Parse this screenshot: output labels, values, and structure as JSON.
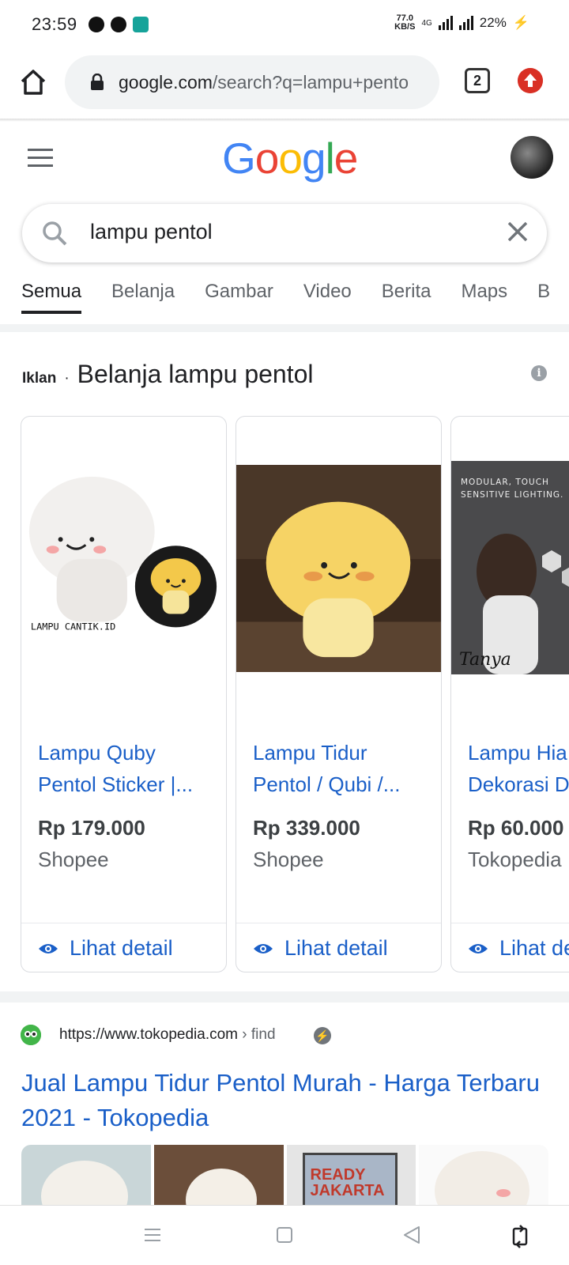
{
  "status_bar": {
    "time": "23:59",
    "net_speed_value": "77.0",
    "net_speed_unit": "KB/S",
    "network_type": "4G",
    "battery": "22%"
  },
  "browser": {
    "url_host": "google.com",
    "url_path": "/search?q=lampu+pento",
    "tab_count": "2"
  },
  "google": {
    "logo_letters": [
      "G",
      "o",
      "o",
      "g",
      "l",
      "e"
    ],
    "logo_colors": [
      "#4285F4",
      "#EA4335",
      "#FBBC05",
      "#4285F4",
      "#34A853",
      "#EA4335"
    ],
    "search_query": "lampu pentol",
    "tabs": [
      {
        "label": "Semua",
        "active": true
      },
      {
        "label": "Belanja",
        "active": false
      },
      {
        "label": "Gambar",
        "active": false
      },
      {
        "label": "Video",
        "active": false
      },
      {
        "label": "Berita",
        "active": false
      },
      {
        "label": "Maps",
        "active": false
      },
      {
        "label": "B",
        "active": false
      }
    ]
  },
  "ads": {
    "iklan_label": "Iklan",
    "separator": "·",
    "title": "Belanja lampu pentol",
    "info_icon": "i",
    "cards": [
      {
        "name": "Lampu Quby Pentol Sticker |...",
        "price": "Rp 179.000",
        "store": "Shopee",
        "detail_label": "Lihat detail",
        "image_watermark": "LAMPU CANTIK.ID"
      },
      {
        "name": "Lampu Tidur Pentol / Qubi /...",
        "price": "Rp 339.000",
        "store": "Shopee",
        "detail_label": "Lihat detail"
      },
      {
        "name": "Lampu Hia Dekorasi D",
        "price": "Rp 60.000",
        "store": "Tokopedia",
        "detail_label": "Lihat de",
        "image_caption": "MODULAR, TOUCH SENSITIVE LIGHTING.",
        "image_brand": "Tanya"
      }
    ]
  },
  "result": {
    "url": "https://www.tokopedia.com",
    "crumb": " › find",
    "title": "Jual Lampu Tidur Pentol Murah - Harga Terbaru 2021 - Tokopedia",
    "thumb_text": "READY JAKARTA"
  },
  "colors": {
    "link_blue": "#1a5fc8",
    "alert_red": "#d93025"
  }
}
